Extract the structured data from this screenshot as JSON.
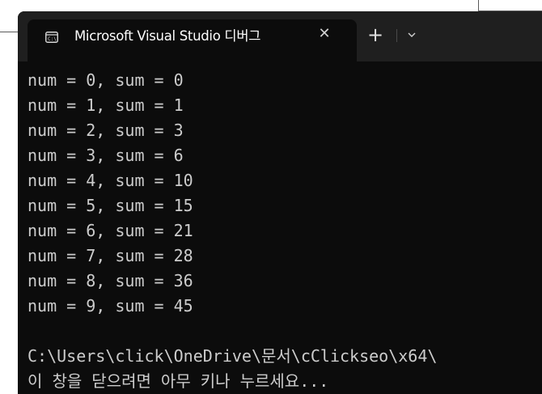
{
  "window": {
    "tab_title": "Microsoft Visual Studio 디버그",
    "tab_close": "✕",
    "new_tab": "+",
    "icons": {
      "tab": "console-app-icon",
      "close": "close-icon",
      "add": "plus-icon",
      "dropdown": "chevron-down-icon"
    },
    "colors": {
      "console_bg": "#0c0c0c",
      "titlebar_bg": "#1f1f1f",
      "text": "#cccccc"
    }
  },
  "console": {
    "lines": [
      "num = 0, sum = 0",
      "num = 1, sum = 1",
      "num = 2, sum = 3",
      "num = 3, sum = 6",
      "num = 4, sum = 10",
      "num = 5, sum = 15",
      "num = 6, sum = 21",
      "num = 7, sum = 28",
      "num = 8, sum = 36",
      "num = 9, sum = 45",
      "",
      "C:\\Users\\click\\OneDrive\\문서\\cClickseo\\x64\\",
      "이 창을 닫으려면 아무 키나 누르세요..."
    ]
  }
}
